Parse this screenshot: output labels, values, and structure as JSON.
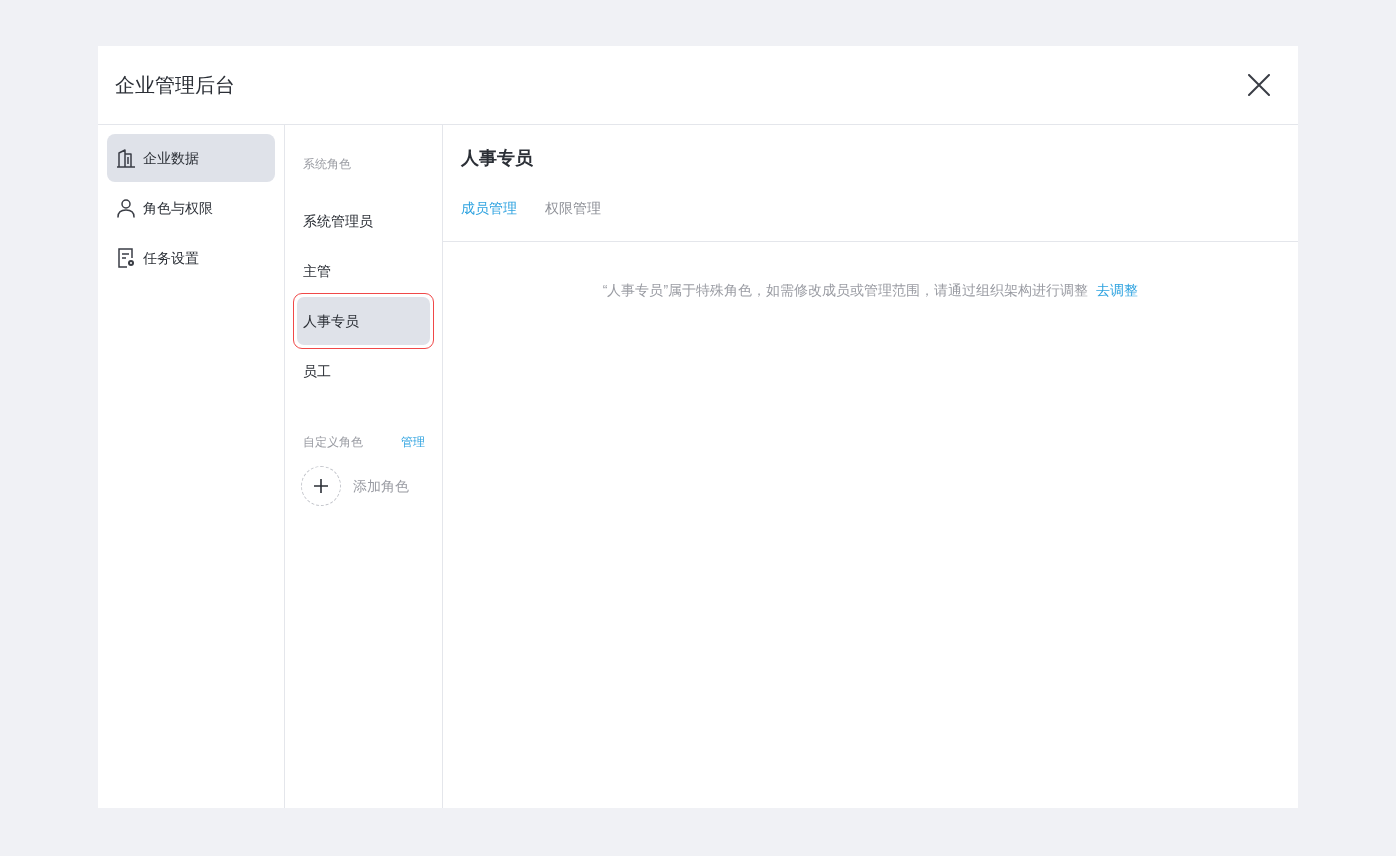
{
  "window": {
    "title": "企业管理后台"
  },
  "sidebar": {
    "items": [
      {
        "label": "企业数据",
        "selected": true
      },
      {
        "label": "角色与权限",
        "selected": false
      },
      {
        "label": "任务设置",
        "selected": false
      }
    ]
  },
  "roles": {
    "system_heading": "系统角色",
    "system_roles": [
      {
        "label": "系统管理员",
        "selected": false,
        "highlighted": false
      },
      {
        "label": "主管",
        "selected": false,
        "highlighted": false
      },
      {
        "label": "人事专员",
        "selected": true,
        "highlighted": true
      },
      {
        "label": "员工",
        "selected": false,
        "highlighted": false
      }
    ],
    "custom_heading": "自定义角色",
    "manage_link": "管理",
    "add_button": "添加角色"
  },
  "detail": {
    "title": "人事专员",
    "tabs": [
      {
        "label": "成员管理",
        "selected": true
      },
      {
        "label": "权限管理",
        "selected": false
      }
    ],
    "notice": "“人事专员”属于特殊角色，如需修改成员或管理范围，请通过组织架构进行调整",
    "notice_link": "去调整"
  }
}
